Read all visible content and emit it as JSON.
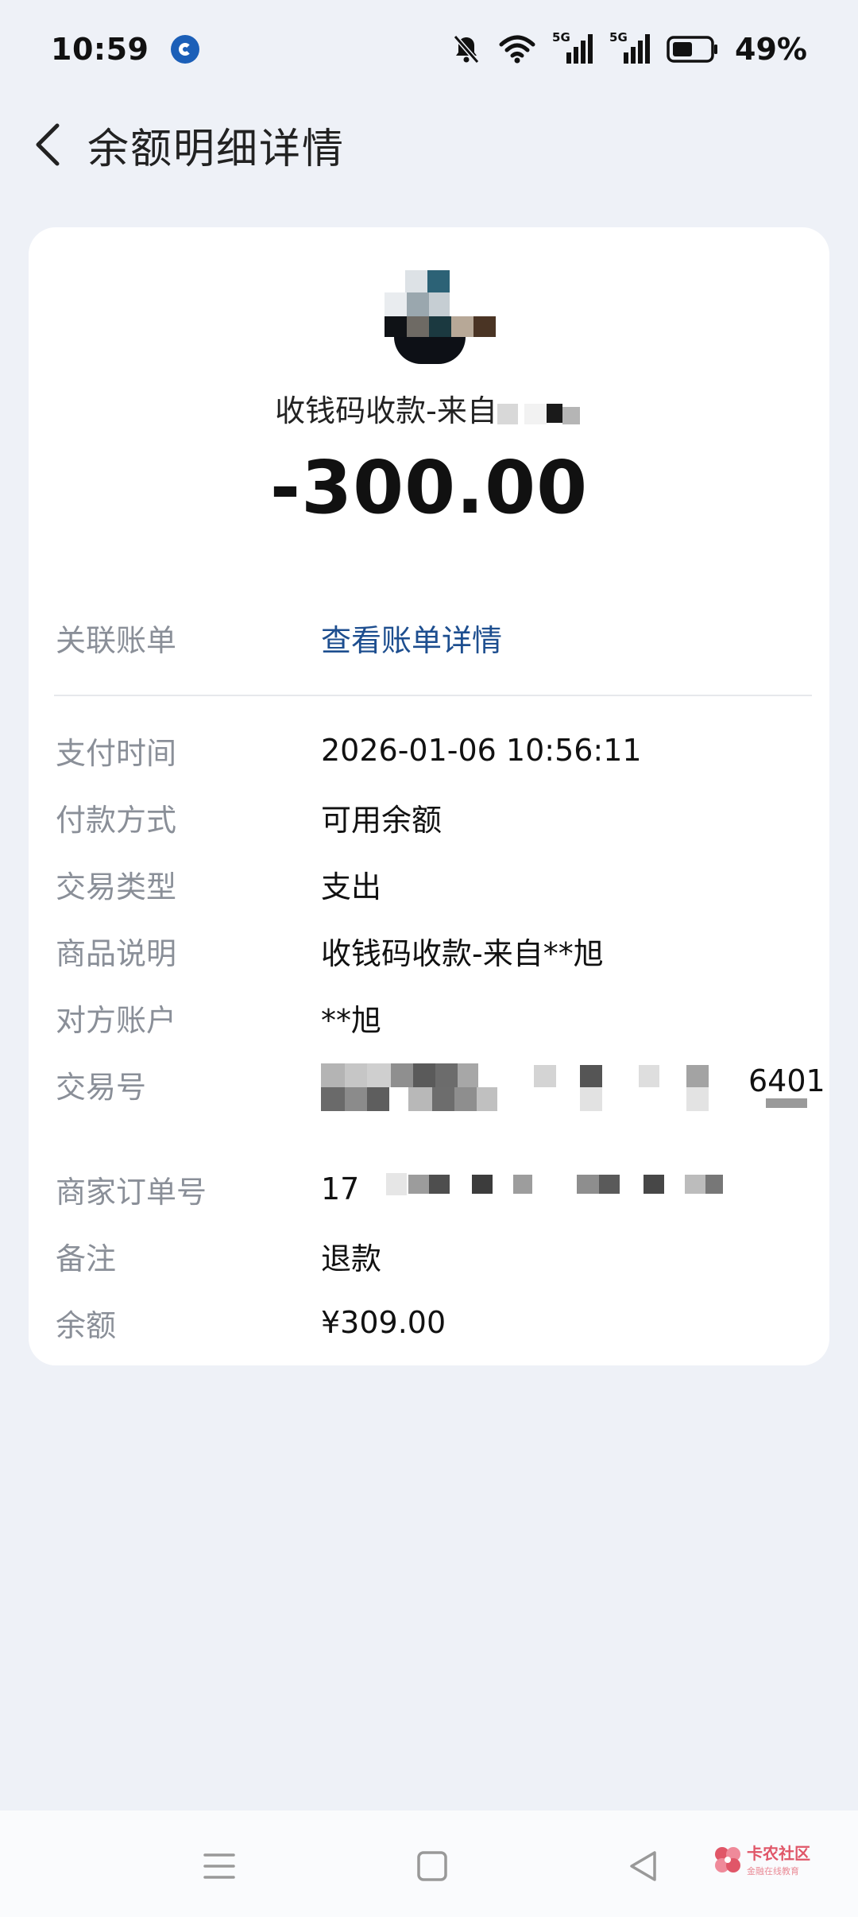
{
  "status_bar": {
    "time": "10:59",
    "battery_percent": "49%",
    "network_label_1": "5G",
    "network_label_2": "5G",
    "icons": [
      "app-badge-icon",
      "mute-bell-icon",
      "wifi-icon",
      "signal-icon",
      "signal-icon",
      "battery-icon"
    ]
  },
  "header": {
    "title": "余额明细详情",
    "back_icon": "chevron-left-icon"
  },
  "summary": {
    "merchant": "收钱码收款-来自",
    "amount": "-300.00"
  },
  "details": {
    "linked_bill": {
      "label": "关联账单",
      "value": "查看账单详情"
    },
    "rows": [
      {
        "label": "支付时间",
        "value": "2026-01-06 10:56:11"
      },
      {
        "label": "付款方式",
        "value": "可用余额"
      },
      {
        "label": "交易类型",
        "value": "支出"
      },
      {
        "label": "商品说明",
        "value": "收钱码收款-来自**旭"
      },
      {
        "label": "对方账户",
        "value": "**旭"
      },
      {
        "label": "交易号",
        "value": "6401"
      },
      {
        "label": "商家订单号",
        "value": "17"
      },
      {
        "label": "备注",
        "value": "退款"
      },
      {
        "label": "余额",
        "value": "¥309.00"
      }
    ]
  },
  "nav_bar": {
    "icons": [
      "menu-icon",
      "home-square-icon",
      "back-triangle-icon"
    ]
  },
  "watermark": {
    "brand": "卡农社区",
    "tagline": "金融在线教育"
  },
  "colors": {
    "background": "#eef1f7",
    "card": "#ffffff",
    "label": "#8a8f98",
    "link": "#1d4e8f",
    "watermark": "#e05668"
  }
}
